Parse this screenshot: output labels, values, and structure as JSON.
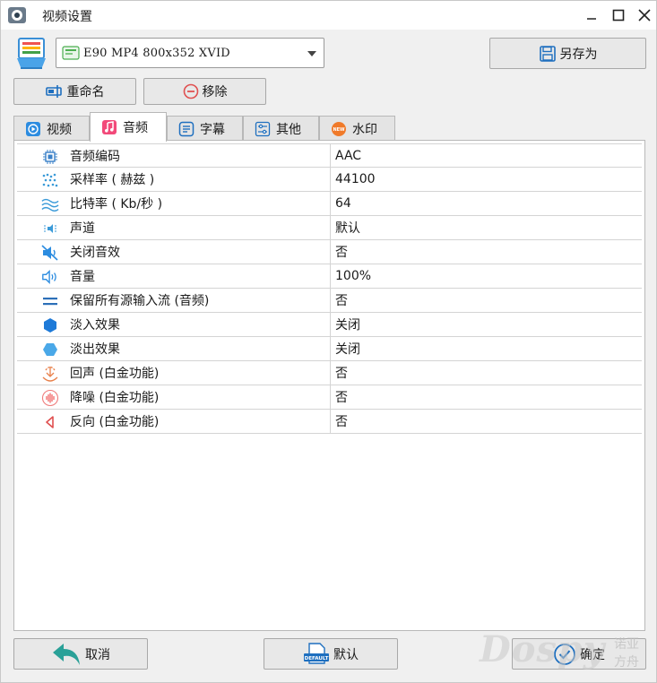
{
  "window": {
    "title": "视频设置"
  },
  "profile": {
    "selected": "E90 MP4 800x352 XVID"
  },
  "toolbar": {
    "save_as": "另存为",
    "rename": "重命名",
    "remove": "移除"
  },
  "tabs": [
    {
      "label": "视频",
      "icon": "play-circle-icon"
    },
    {
      "label": "音频",
      "icon": "music-note-icon"
    },
    {
      "label": "字幕",
      "icon": "subtitle-icon"
    },
    {
      "label": "其他",
      "icon": "sliders-icon"
    },
    {
      "label": "水印",
      "icon": "new-badge-icon"
    }
  ],
  "active_tab": "音频",
  "properties": [
    {
      "name": "音频编码",
      "value": "AAC",
      "icon": "chip-icon"
    },
    {
      "name": "采样率 ( 赫兹 )",
      "value": "44100",
      "icon": "sample-dots-icon"
    },
    {
      "name": "比特率 ( Kb/秒 )",
      "value": "64",
      "icon": "waves-icon"
    },
    {
      "name": "声道",
      "value": "默认",
      "icon": "channel-icon"
    },
    {
      "name": "关闭音效",
      "value": "否",
      "icon": "mute-icon"
    },
    {
      "name": "音量",
      "value": "100%",
      "icon": "volume-icon"
    },
    {
      "name": "保留所有源输入流 (音频)",
      "value": "否",
      "icon": "equals-icon"
    },
    {
      "name": "淡入效果",
      "value": "关闭",
      "icon": "hexagon-dark-icon"
    },
    {
      "name": "淡出效果",
      "value": "关闭",
      "icon": "hexagon-light-icon"
    },
    {
      "name": "回声 (白金功能)",
      "value": "否",
      "icon": "echo-icon"
    },
    {
      "name": "降噪 (白金功能)",
      "value": "否",
      "icon": "noise-icon"
    },
    {
      "name": "反向 (白金功能)",
      "value": "否",
      "icon": "reverse-icon"
    }
  ],
  "footer": {
    "cancel": "取消",
    "default": "默认",
    "default_badge": "DEFAULT",
    "ok": "确定"
  },
  "watermark": {
    "text": "Dospy",
    "cn": "诺亚方舟"
  },
  "colors": {
    "accent": "#1e88e5",
    "teal": "#2aa198",
    "red": "#e05050",
    "orange": "#f07a2a"
  }
}
